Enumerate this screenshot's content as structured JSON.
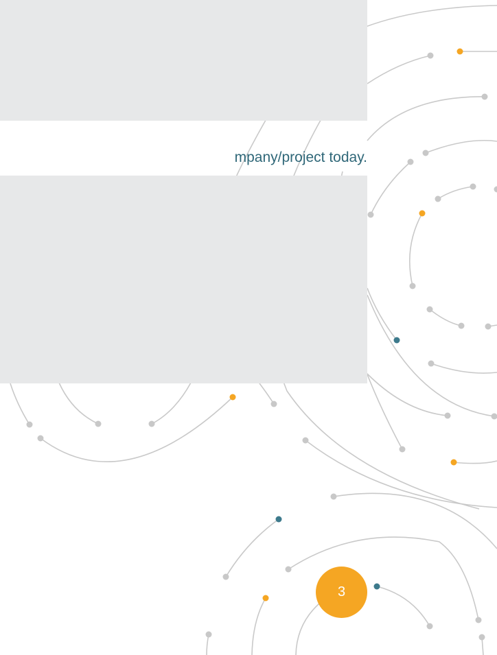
{
  "document": {
    "body_text_visible": "mpany/project today.",
    "page_number": "3"
  },
  "colors": {
    "accent_orange": "#f5a623",
    "accent_teal": "#3d7a8c",
    "arc_gray": "#c9c9c9",
    "dot_gray": "#c8c8c8",
    "text_teal": "#2f6778",
    "panel_gray": "#e7e8e9"
  }
}
